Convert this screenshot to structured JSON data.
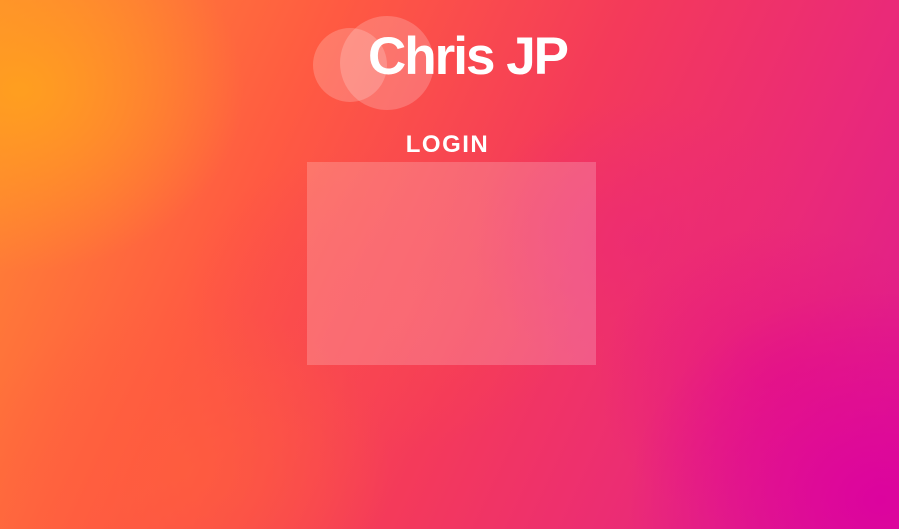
{
  "logo": {
    "text": "Chris JP"
  },
  "login": {
    "title": "LOGIN"
  },
  "colors": {
    "background_start": "#ff8c32",
    "background_mid": "#f43a5a",
    "background_end": "#dc1a92",
    "text": "#ffffff"
  }
}
